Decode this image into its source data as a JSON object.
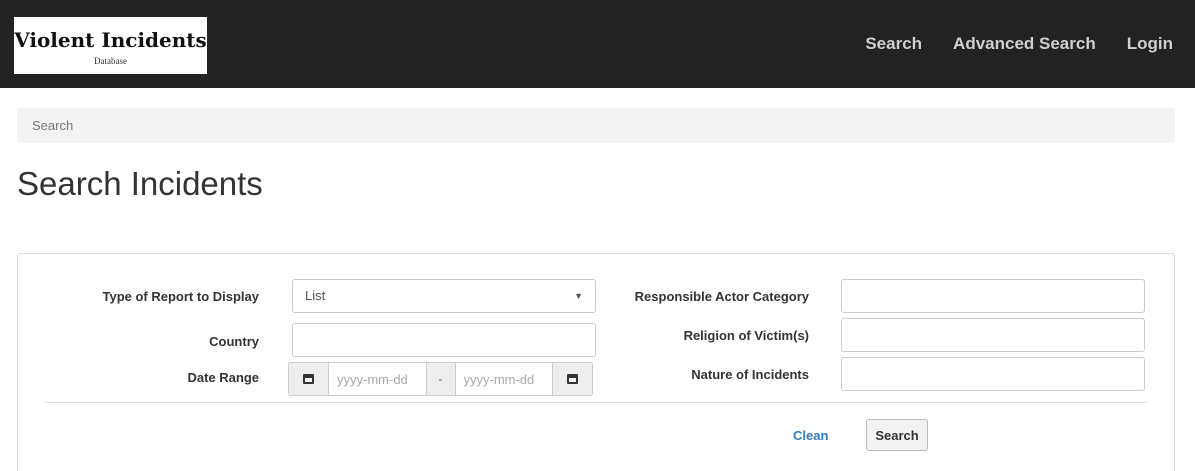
{
  "navbar": {
    "brand_title": "Violent Incidents",
    "brand_subtitle": "Database",
    "links": [
      "Search",
      "Advanced Search",
      "Login"
    ]
  },
  "breadcrumb": {
    "current": "Search"
  },
  "page": {
    "title": "Search Incidents"
  },
  "form": {
    "report_type": {
      "label": "Type of Report to Display",
      "value": "List"
    },
    "country": {
      "label": "Country",
      "value": ""
    },
    "date_range": {
      "label": "Date Range",
      "start_placeholder": "yyyy-mm-dd",
      "end_placeholder": "yyyy-mm-dd",
      "separator": "-",
      "icon": "calendar-icon"
    },
    "actor_category": {
      "label": "Responsible Actor Category",
      "value": ""
    },
    "victim_religion": {
      "label": "Religion of Victim(s)",
      "value": ""
    },
    "incident_nature": {
      "label": "Nature of Incidents",
      "value": ""
    },
    "clean_label": "Clean",
    "search_label": "Search"
  },
  "colors": {
    "navbar_bg": "#222222",
    "nav_link": "#cfcfcf",
    "link_blue": "#337ab7"
  }
}
